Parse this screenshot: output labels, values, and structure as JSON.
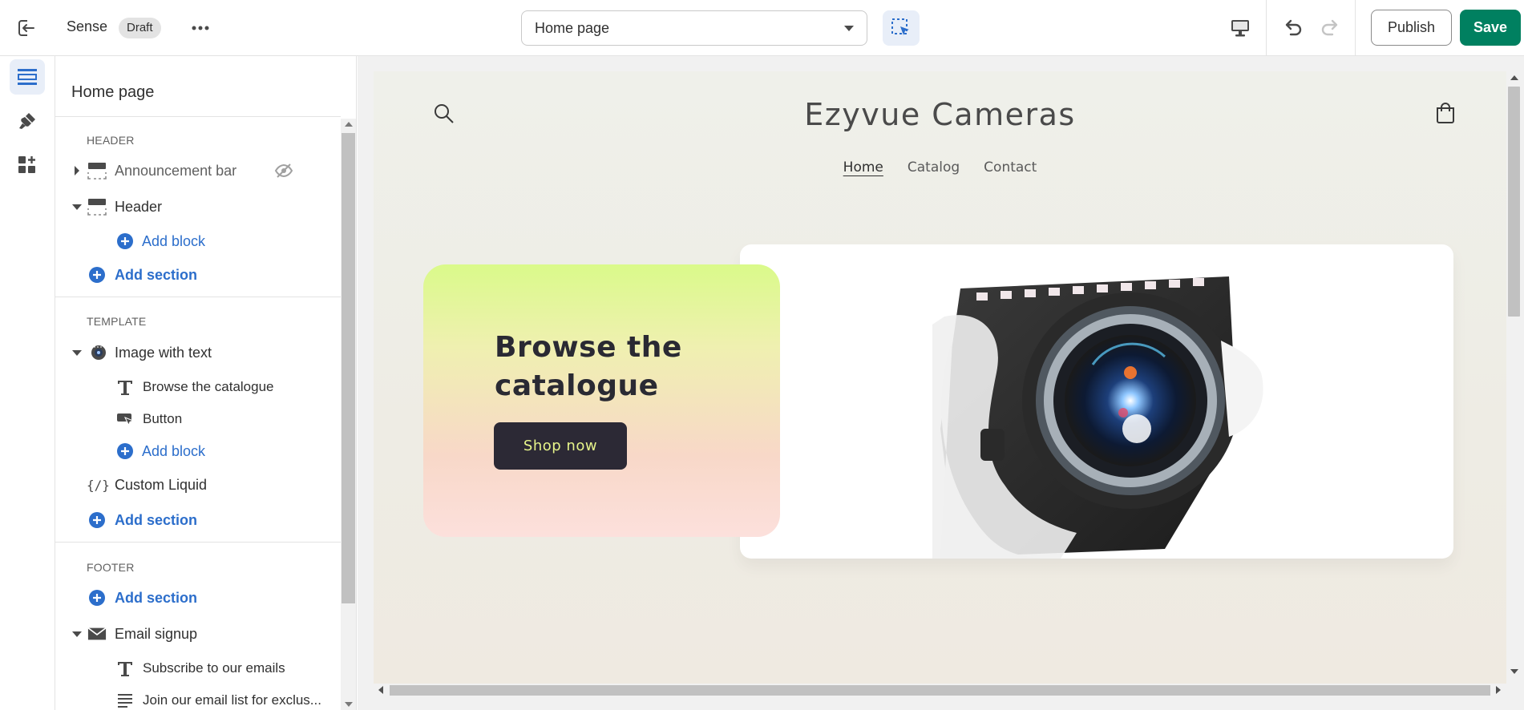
{
  "topbar": {
    "theme_name": "Sense",
    "status_badge": "Draft",
    "page_select_value": "Home page",
    "publish_label": "Publish",
    "save_label": "Save"
  },
  "sidebar": {
    "title": "Home page",
    "groups": {
      "header": "HEADER",
      "template": "TEMPLATE",
      "footer": "FOOTER"
    },
    "items": {
      "announcement_bar": "Announcement bar",
      "header": "Header",
      "header_add_block": "Add block",
      "header_add_section": "Add section",
      "image_with_text": "Image with text",
      "browse_catalogue": "Browse the catalogue",
      "button": "Button",
      "template_add_block": "Add block",
      "custom_liquid": "Custom Liquid",
      "template_add_section": "Add section",
      "footer_add_section": "Add section",
      "email_signup": "Email signup",
      "subscribe": "Subscribe to our emails",
      "join_list": "Join our email list for exclus..."
    }
  },
  "preview": {
    "store_title": "Ezyvue Cameras",
    "nav": [
      "Home",
      "Catalog",
      "Contact"
    ],
    "heading_line1": "Browse the",
    "heading_line2": "catalogue",
    "button_label": "Shop now"
  },
  "colors": {
    "accent_blue": "#2c6ecb",
    "save_green": "#008060",
    "button_dark": "#2c2935",
    "button_text": "#e6f48a"
  }
}
